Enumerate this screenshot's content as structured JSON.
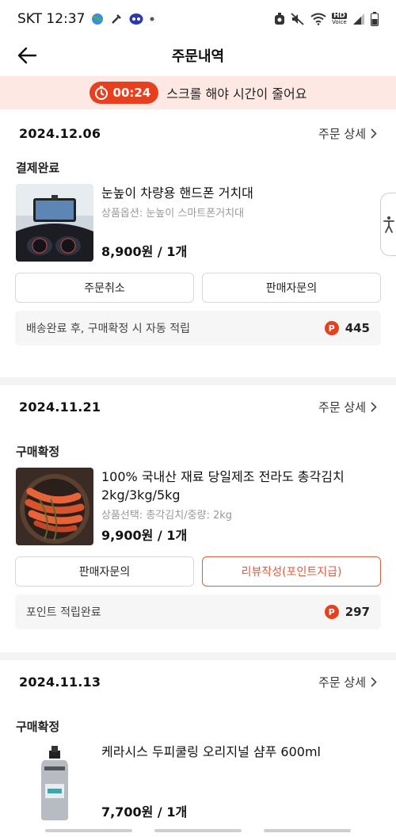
{
  "status_bar": {
    "carrier_time": "SKT 12:37",
    "hd_label": "HD",
    "voice_label": "Voice"
  },
  "app_bar": {
    "title": "주문내역"
  },
  "timer_banner": {
    "time": "00:24",
    "message": "스크롤 해야 시간이 줄어요",
    "accent_color": "#e8401e"
  },
  "orders": [
    {
      "date": "2024.12.06",
      "detail_label": "주문 상세",
      "status": "결제완료",
      "product_name": "눈높이 차량용 핸드폰 거치대",
      "option": "상품옵션: 눈높이 스마트폰거치대",
      "price": "8,900원 / 1개",
      "buttons": [
        "주문취소",
        "판매자문의"
      ],
      "points_text": "배송완료 후, 구매확정 시 자동 적립",
      "points_badge": "P",
      "points_value": "445"
    },
    {
      "date": "2024.11.21",
      "detail_label": "주문 상세",
      "status": "구매확정",
      "product_name": "100% 국내산 재료 당일제조 전라도 총각김치 2kg/3kg/5kg",
      "option": "상품선택: 총각김치/중량: 2kg",
      "price": "9,900원 / 1개",
      "buttons": [
        "판매자문의",
        "리뷰작성(포인트지급)"
      ],
      "points_text": "포인트 적립완료",
      "points_badge": "P",
      "points_value": "297"
    },
    {
      "date": "2024.11.13",
      "detail_label": "주문 상세",
      "status": "구매확정",
      "product_name": "케라시스 두피쿨링 오리지널 샴푸 600ml",
      "price": "7,700원 / 1개"
    }
  ]
}
